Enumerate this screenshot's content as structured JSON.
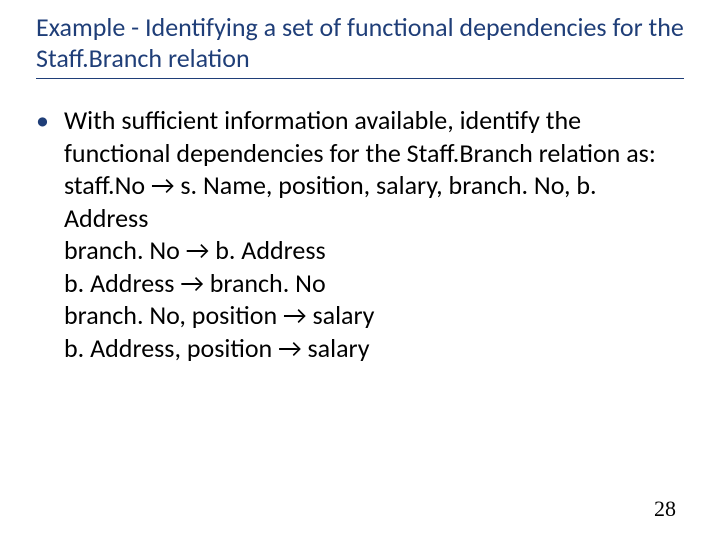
{
  "title": "Example - Identifying a set of functional dependencies for the Staff.Branch relation",
  "bullet": {
    "lead": "With sufficient information available, identify the functional dependencies for the Staff.Branch relation as:",
    "lines": [
      "staff.No → s. Name, position, salary, branch. No, b. Address",
      "branch. No → b. Address",
      "b. Address → branch. No",
      "branch. No, position → salary",
      "b. Address, position → salary"
    ]
  },
  "page_number": "28",
  "bullet_char": "•"
}
